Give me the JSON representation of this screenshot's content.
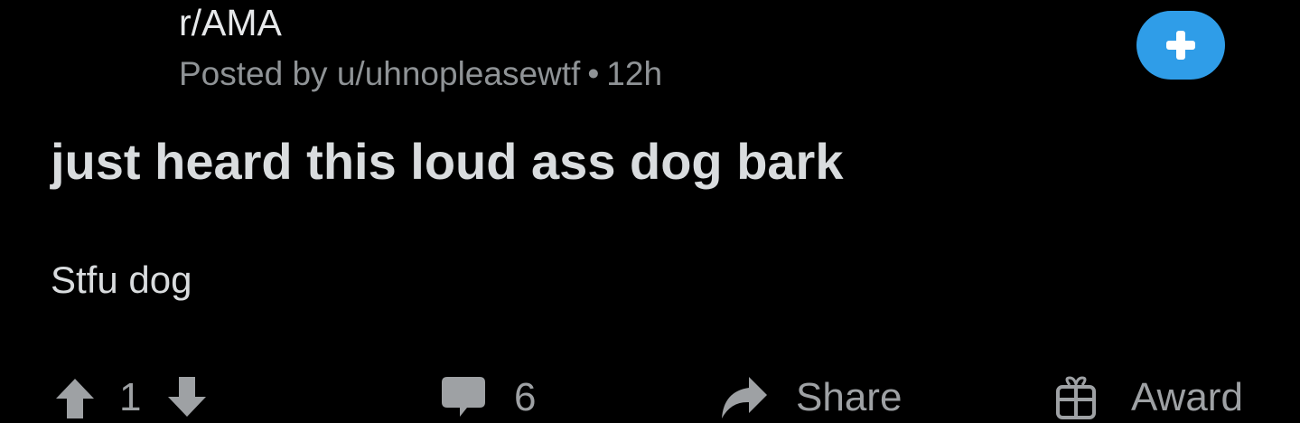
{
  "post": {
    "subreddit": "r/AMA",
    "posted_by_prefix": "Posted by",
    "author": "u/uhnopleasewtf",
    "separator": "•",
    "age": "12h",
    "title": "just heard this loud ass dog bark",
    "body": "Stfu dog"
  },
  "actions": {
    "score": "1",
    "comments": "6",
    "share_label": "Share",
    "award_label": "Award"
  },
  "icons": {
    "join": "plus-icon",
    "upvote": "arrow-up-icon",
    "downvote": "arrow-down-icon",
    "comments": "comment-bubble-icon",
    "share": "share-arrow-icon",
    "award": "gift-icon"
  },
  "colors": {
    "background": "#000000",
    "accent": "#2f9de8",
    "text_primary": "#d9dcde",
    "text_meta": "#8f9396",
    "icon_gray": "#9ea1a4"
  }
}
